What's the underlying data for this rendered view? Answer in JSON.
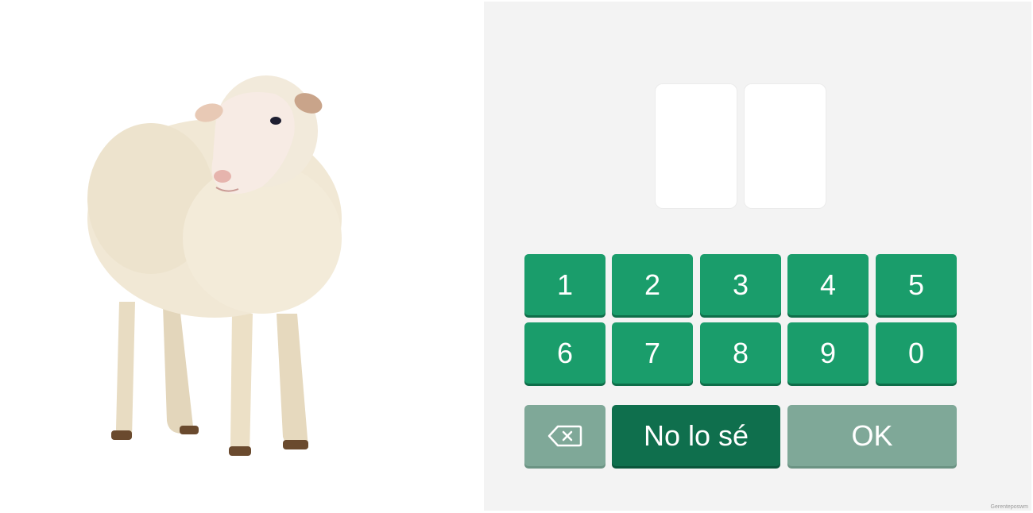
{
  "illustration": {
    "subject": "sheep",
    "icon": "sheep-icon"
  },
  "answer": {
    "digits": [
      "",
      ""
    ]
  },
  "keypad": {
    "digit_keys": [
      "1",
      "2",
      "3",
      "4",
      "5",
      "6",
      "7",
      "8",
      "9",
      "0"
    ],
    "backspace_icon": "backspace-icon",
    "unknown_label": "No lo sé",
    "ok_label": "OK"
  },
  "watermark": "Gerenteposwm"
}
